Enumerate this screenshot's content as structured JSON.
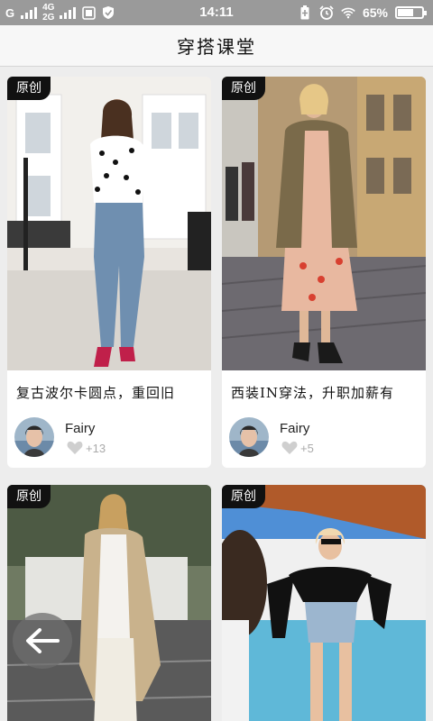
{
  "status_bar": {
    "carrier": "G",
    "net_top": "4G",
    "net_bottom": "2G",
    "time": "14:11",
    "battery": "65%",
    "battery_level": 0.65
  },
  "header": {
    "title": "穿搭课堂"
  },
  "cards": [
    {
      "badge": "原创",
      "title": "复古波尔卡圆点，重回旧",
      "author": "Fairy",
      "likes": "+13"
    },
    {
      "badge": "原创",
      "title": "西装IN穿法，升职加薪有",
      "author": "Fairy",
      "likes": "+5"
    },
    {
      "badge": "原创"
    },
    {
      "badge": "原创"
    }
  ],
  "colors": {
    "badge_bg": "#111111",
    "page_bg": "#ededed",
    "status_bg": "#9a9a9a"
  },
  "icons": {
    "back": "arrow-left-icon",
    "like": "heart-icon"
  }
}
